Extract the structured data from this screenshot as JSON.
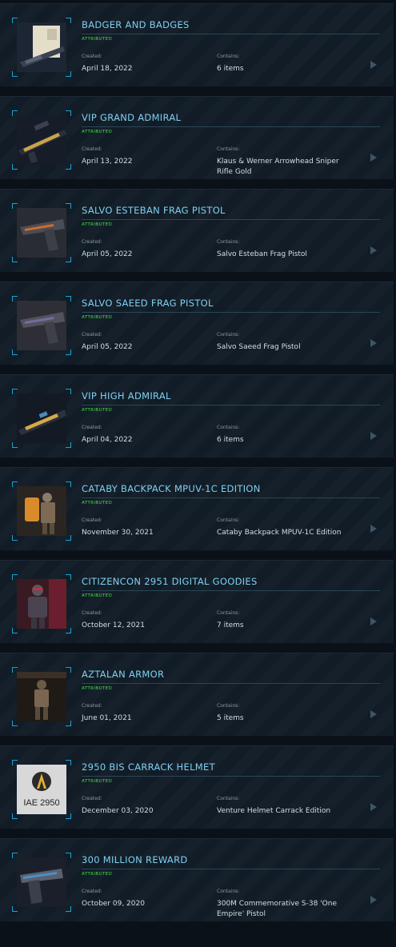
{
  "labels": {
    "created": "Created:",
    "contains": "Contains:"
  },
  "items": [
    {
      "title": "BADGER AND BADGES",
      "status": "ATTRIBUTED",
      "created": "April 18, 2022",
      "contains": "6 items",
      "thumb": "rifle-with-card-thumbnail"
    },
    {
      "title": "VIP GRAND ADMIRAL",
      "status": "ATTRIBUTED",
      "created": "April 13, 2022",
      "contains": "Klaus & Werner Arrowhead Sniper Rifle Gold",
      "thumb": "gold-sniper-rifle-thumbnail"
    },
    {
      "title": "SALVO ESTEBAN FRAG PISTOL",
      "status": "ATTRIBUTED",
      "created": "April 05, 2022",
      "contains": "Salvo Esteban Frag Pistol",
      "thumb": "pistol-thumbnail"
    },
    {
      "title": "SALVO SAEED FRAG PISTOL",
      "status": "ATTRIBUTED",
      "created": "April 05, 2022",
      "contains": "Salvo Saeed Frag Pistol",
      "thumb": "pistol-thumbnail"
    },
    {
      "title": "VIP HIGH ADMIRAL",
      "status": "ATTRIBUTED",
      "created": "April 04, 2022",
      "contains": "6 items",
      "thumb": "gold-rifle-thumbnail"
    },
    {
      "title": "CATABY BACKPACK MPUV-1C EDITION",
      "status": "ATTRIBUTED",
      "created": "November 30, 2021",
      "contains": "Cataby Backpack MPUV-1C Edition",
      "thumb": "backpack-thumbnail"
    },
    {
      "title": "CITIZENCON 2951 DIGITAL GOODIES",
      "status": "ATTRIBUTED",
      "created": "October 12, 2021",
      "contains": "7 items",
      "thumb": "armored-character-thumbnail"
    },
    {
      "title": "AZTALAN ARMOR",
      "status": "ATTRIBUTED",
      "created": "June 01, 2021",
      "contains": "5 items",
      "thumb": "armor-figure-thumbnail"
    },
    {
      "title": "2950 BIS CARRACK HELMET",
      "status": "ATTRIBUTED",
      "created": "December 03, 2020",
      "contains": "Venture Helmet Carrack Edition",
      "thumb": "iae-logo-thumbnail",
      "logo_text": "IAE 2950"
    },
    {
      "title": "300 MILLION REWARD",
      "status": "ATTRIBUTED",
      "created": "October 09, 2020",
      "contains": "300M Commemorative S-38 'One Empire' Pistol",
      "thumb": "commemorative-pistol-thumbnail"
    }
  ]
}
